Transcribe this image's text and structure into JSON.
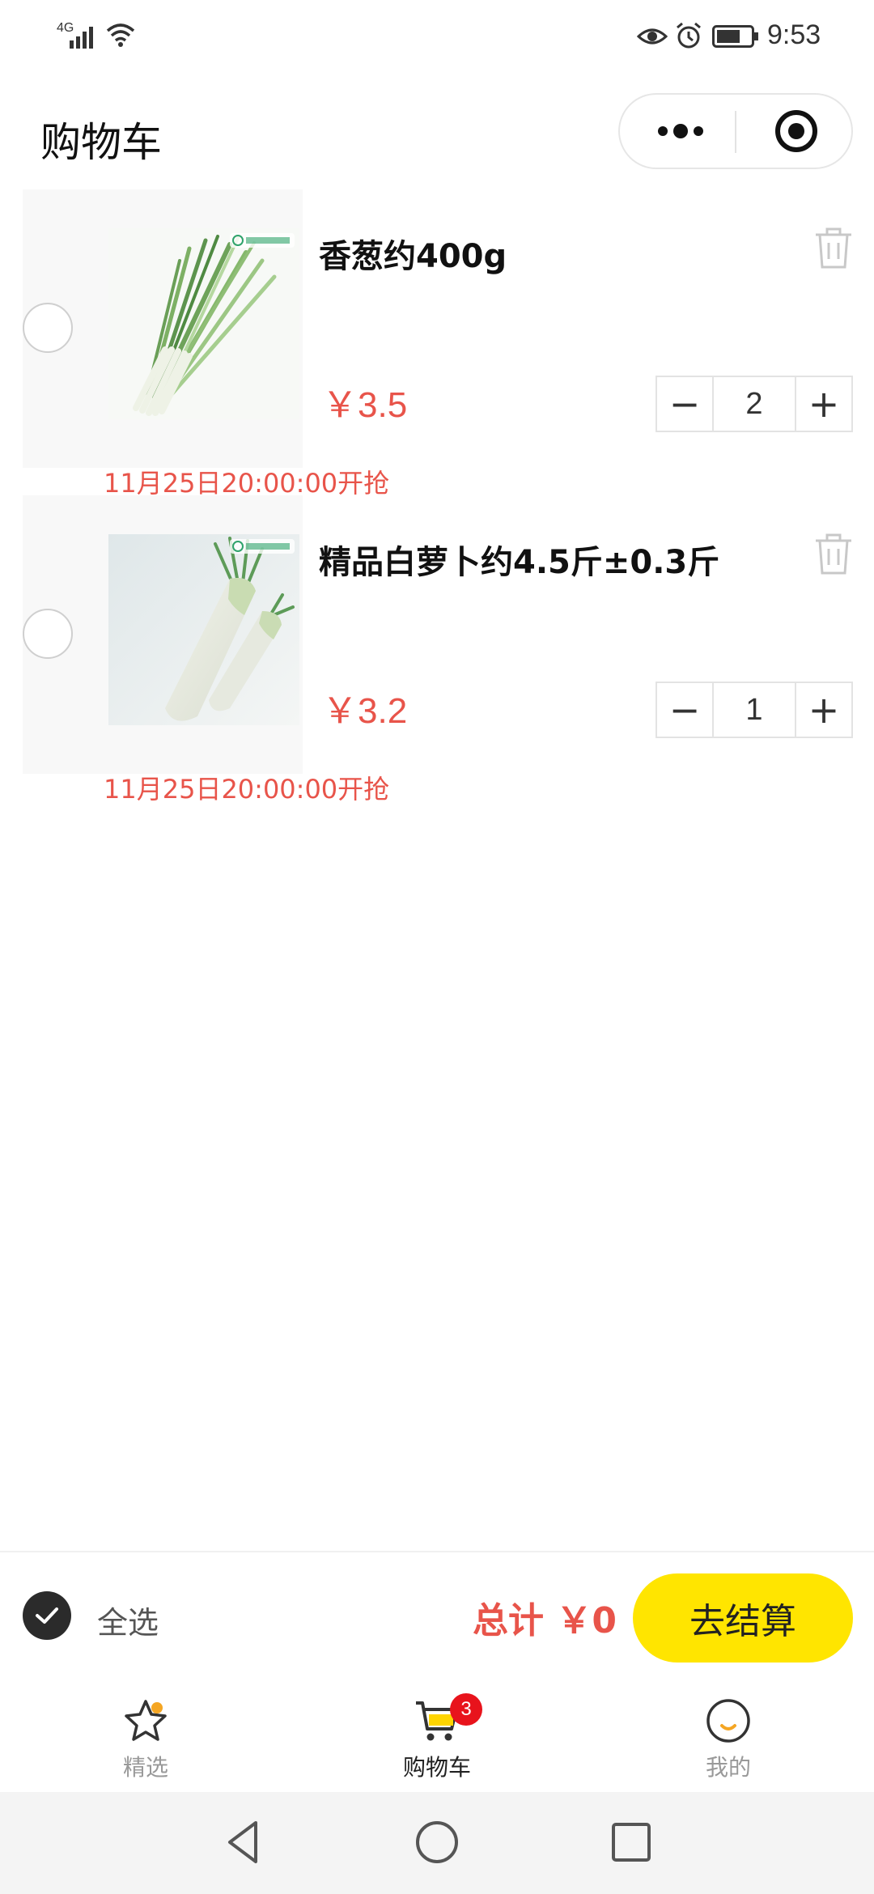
{
  "status_bar": {
    "network": "4G",
    "time": "9:53",
    "icons": [
      "signal-icon",
      "wifi-icon",
      "eye-icon",
      "alarm-icon",
      "battery-icon"
    ]
  },
  "nav_bar": {
    "title": "购物车",
    "capsule": [
      "more-icon",
      "close-target-icon"
    ]
  },
  "cart": {
    "items": [
      {
        "name": "香葱约400g",
        "price": "￥3.5",
        "quantity": "2",
        "flash_time": "11月25日20:00:00开抢",
        "selected": false,
        "image": "green-onion-image"
      },
      {
        "name": "精品白萝卜约4.5斤±0.3斤",
        "price": "￥3.2",
        "quantity": "1",
        "flash_time": "11月25日20:00:00开抢",
        "selected": false,
        "image": "white-radish-image"
      }
    ],
    "minus_label": "−",
    "plus_label": "+"
  },
  "checkout_bar": {
    "select_all_label": "全选",
    "select_all_checked": true,
    "total_label": "总计 ￥0",
    "checkout_label": "去结算"
  },
  "tab_bar": {
    "tabs": [
      {
        "label": "精选",
        "icon": "star-icon",
        "active": false
      },
      {
        "label": "购物车",
        "icon": "cart-icon",
        "active": true,
        "badge": "3"
      },
      {
        "label": "我的",
        "icon": "profile-icon",
        "active": false
      }
    ]
  },
  "colors": {
    "price_red": "#e8544a",
    "checkout_yellow": "#ffe500",
    "badge_red": "#e8131c"
  },
  "system_nav": [
    "back-icon",
    "home-icon",
    "recent-apps-icon"
  ]
}
